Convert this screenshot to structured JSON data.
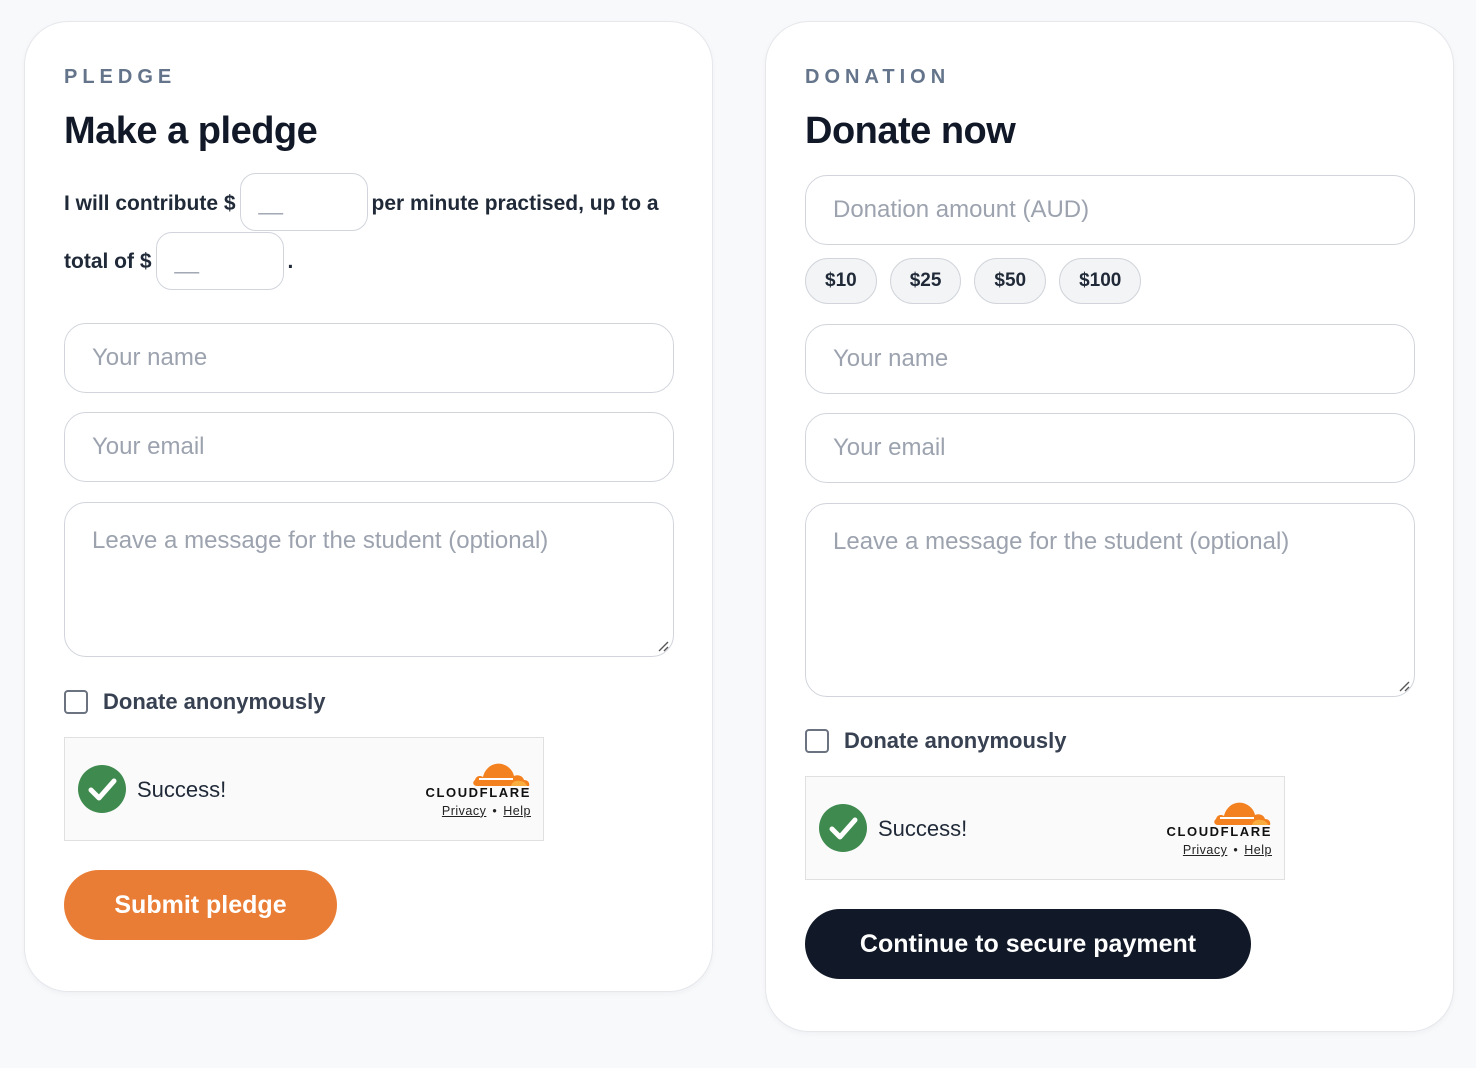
{
  "pledge": {
    "eyebrow": "PLEDGE",
    "title": "Make a pledge",
    "sentence_part1": "I will contribute $",
    "rate_placeholder": "__",
    "sentence_part2": "per minute practised, up to a total of $",
    "total_placeholder": "__",
    "sentence_end": ".",
    "name_placeholder": "Your name",
    "email_placeholder": "Your email",
    "message_placeholder": "Leave a message for the student (optional)",
    "anonymous_label": "Donate anonymously",
    "captcha": {
      "status": "Success!",
      "brand": "CLOUDFLARE",
      "privacy": "Privacy",
      "help": "Help"
    },
    "submit_label": "Submit pledge"
  },
  "donation": {
    "eyebrow": "DONATION",
    "title": "Donate now",
    "amount_placeholder": "Donation amount (AUD)",
    "preset_amounts": [
      "$10",
      "$25",
      "$50",
      "$100"
    ],
    "name_placeholder": "Your name",
    "email_placeholder": "Your email",
    "message_placeholder": "Leave a message for the student (optional)",
    "anonymous_label": "Donate anonymously",
    "captcha": {
      "status": "Success!",
      "brand": "CLOUDFLARE",
      "privacy": "Privacy",
      "help": "Help"
    },
    "submit_label": "Continue to secure payment"
  },
  "colors": {
    "accent_orange": "#e97d35",
    "dark_button": "#111827",
    "success_green": "#3f8a4f",
    "cloudflare_orange": "#f48120"
  }
}
